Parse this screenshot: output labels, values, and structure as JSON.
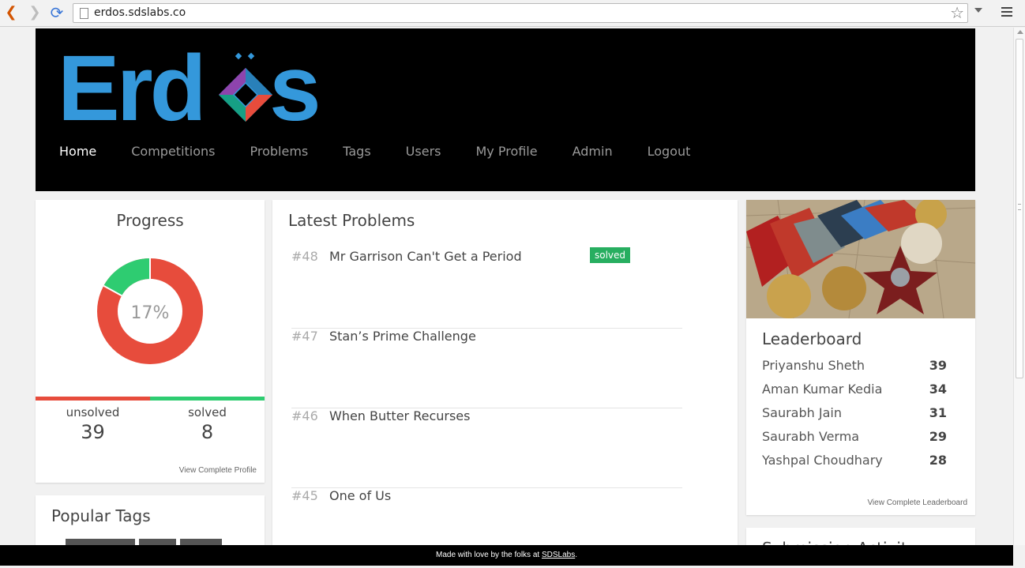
{
  "browser": {
    "url": "erdos.sdslabs.co"
  },
  "brand": {
    "logo_text": "Erdos",
    "logo_color": "#3498db"
  },
  "nav": {
    "items": [
      {
        "label": "Home"
      },
      {
        "label": "Competitions"
      },
      {
        "label": "Problems"
      },
      {
        "label": "Tags"
      },
      {
        "label": "Users"
      },
      {
        "label": "My Profile"
      },
      {
        "label": "Admin"
      },
      {
        "label": "Logout"
      }
    ],
    "active": "Home"
  },
  "progress": {
    "title": "Progress",
    "percent_label": "17%",
    "solved_fraction": 0.17,
    "unsolved_label": "unsolved",
    "unsolved_count": "39",
    "solved_label": "solved",
    "solved_count": "8",
    "view_link": "View Complete Profile",
    "unsolved_color": "#e74c3c",
    "solved_color": "#2ecc71"
  },
  "popular_tags": {
    "title": "Popular Tags"
  },
  "latest_problems": {
    "title": "Latest Problems",
    "items": [
      {
        "id": "#48",
        "name": "Mr Garrison Can't Get a Period",
        "badge": "solved"
      },
      {
        "id": "#47",
        "name": "Stan’s Prime Challenge",
        "badge": ""
      },
      {
        "id": "#46",
        "name": "When Butter Recurses",
        "badge": ""
      },
      {
        "id": "#45",
        "name": "One of Us",
        "badge": ""
      }
    ]
  },
  "leaderboard": {
    "title": "Leaderboard",
    "rows": [
      {
        "name": "Priyanshu Sheth",
        "score": "39"
      },
      {
        "name": "Aman Kumar Kedia",
        "score": "34"
      },
      {
        "name": "Saurabh Jain",
        "score": "31"
      },
      {
        "name": "Saurabh Verma",
        "score": "29"
      },
      {
        "name": "Yashpal Choudhary",
        "score": "28"
      }
    ],
    "view_link": "View Complete Leaderboard"
  },
  "submission_activity": {
    "title": "Submission Activity"
  },
  "footer": {
    "text": "Made with love by the folks at",
    "link": "SDSLabs",
    "suffix": "."
  }
}
